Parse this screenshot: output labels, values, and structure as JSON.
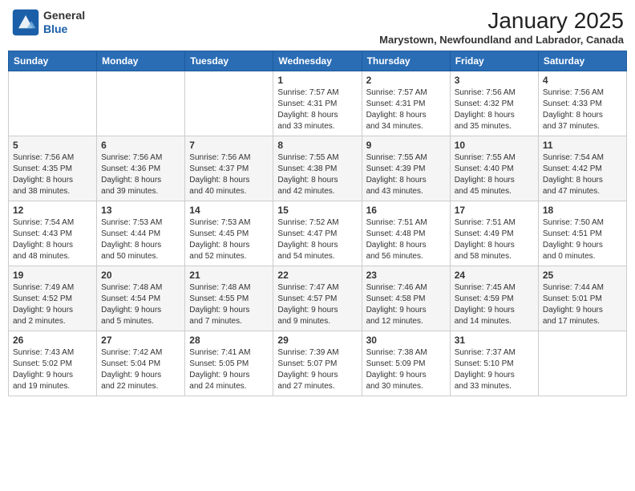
{
  "header": {
    "logo_line1": "General",
    "logo_line2": "Blue",
    "month": "January 2025",
    "location": "Marystown, Newfoundland and Labrador, Canada"
  },
  "weekdays": [
    "Sunday",
    "Monday",
    "Tuesday",
    "Wednesday",
    "Thursday",
    "Friday",
    "Saturday"
  ],
  "weeks": [
    [
      {
        "day": "",
        "info": ""
      },
      {
        "day": "",
        "info": ""
      },
      {
        "day": "",
        "info": ""
      },
      {
        "day": "1",
        "info": "Sunrise: 7:57 AM\nSunset: 4:31 PM\nDaylight: 8 hours\nand 33 minutes."
      },
      {
        "day": "2",
        "info": "Sunrise: 7:57 AM\nSunset: 4:31 PM\nDaylight: 8 hours\nand 34 minutes."
      },
      {
        "day": "3",
        "info": "Sunrise: 7:56 AM\nSunset: 4:32 PM\nDaylight: 8 hours\nand 35 minutes."
      },
      {
        "day": "4",
        "info": "Sunrise: 7:56 AM\nSunset: 4:33 PM\nDaylight: 8 hours\nand 37 minutes."
      }
    ],
    [
      {
        "day": "5",
        "info": "Sunrise: 7:56 AM\nSunset: 4:35 PM\nDaylight: 8 hours\nand 38 minutes."
      },
      {
        "day": "6",
        "info": "Sunrise: 7:56 AM\nSunset: 4:36 PM\nDaylight: 8 hours\nand 39 minutes."
      },
      {
        "day": "7",
        "info": "Sunrise: 7:56 AM\nSunset: 4:37 PM\nDaylight: 8 hours\nand 40 minutes."
      },
      {
        "day": "8",
        "info": "Sunrise: 7:55 AM\nSunset: 4:38 PM\nDaylight: 8 hours\nand 42 minutes."
      },
      {
        "day": "9",
        "info": "Sunrise: 7:55 AM\nSunset: 4:39 PM\nDaylight: 8 hours\nand 43 minutes."
      },
      {
        "day": "10",
        "info": "Sunrise: 7:55 AM\nSunset: 4:40 PM\nDaylight: 8 hours\nand 45 minutes."
      },
      {
        "day": "11",
        "info": "Sunrise: 7:54 AM\nSunset: 4:42 PM\nDaylight: 8 hours\nand 47 minutes."
      }
    ],
    [
      {
        "day": "12",
        "info": "Sunrise: 7:54 AM\nSunset: 4:43 PM\nDaylight: 8 hours\nand 48 minutes."
      },
      {
        "day": "13",
        "info": "Sunrise: 7:53 AM\nSunset: 4:44 PM\nDaylight: 8 hours\nand 50 minutes."
      },
      {
        "day": "14",
        "info": "Sunrise: 7:53 AM\nSunset: 4:45 PM\nDaylight: 8 hours\nand 52 minutes."
      },
      {
        "day": "15",
        "info": "Sunrise: 7:52 AM\nSunset: 4:47 PM\nDaylight: 8 hours\nand 54 minutes."
      },
      {
        "day": "16",
        "info": "Sunrise: 7:51 AM\nSunset: 4:48 PM\nDaylight: 8 hours\nand 56 minutes."
      },
      {
        "day": "17",
        "info": "Sunrise: 7:51 AM\nSunset: 4:49 PM\nDaylight: 8 hours\nand 58 minutes."
      },
      {
        "day": "18",
        "info": "Sunrise: 7:50 AM\nSunset: 4:51 PM\nDaylight: 9 hours\nand 0 minutes."
      }
    ],
    [
      {
        "day": "19",
        "info": "Sunrise: 7:49 AM\nSunset: 4:52 PM\nDaylight: 9 hours\nand 2 minutes."
      },
      {
        "day": "20",
        "info": "Sunrise: 7:48 AM\nSunset: 4:54 PM\nDaylight: 9 hours\nand 5 minutes."
      },
      {
        "day": "21",
        "info": "Sunrise: 7:48 AM\nSunset: 4:55 PM\nDaylight: 9 hours\nand 7 minutes."
      },
      {
        "day": "22",
        "info": "Sunrise: 7:47 AM\nSunset: 4:57 PM\nDaylight: 9 hours\nand 9 minutes."
      },
      {
        "day": "23",
        "info": "Sunrise: 7:46 AM\nSunset: 4:58 PM\nDaylight: 9 hours\nand 12 minutes."
      },
      {
        "day": "24",
        "info": "Sunrise: 7:45 AM\nSunset: 4:59 PM\nDaylight: 9 hours\nand 14 minutes."
      },
      {
        "day": "25",
        "info": "Sunrise: 7:44 AM\nSunset: 5:01 PM\nDaylight: 9 hours\nand 17 minutes."
      }
    ],
    [
      {
        "day": "26",
        "info": "Sunrise: 7:43 AM\nSunset: 5:02 PM\nDaylight: 9 hours\nand 19 minutes."
      },
      {
        "day": "27",
        "info": "Sunrise: 7:42 AM\nSunset: 5:04 PM\nDaylight: 9 hours\nand 22 minutes."
      },
      {
        "day": "28",
        "info": "Sunrise: 7:41 AM\nSunset: 5:05 PM\nDaylight: 9 hours\nand 24 minutes."
      },
      {
        "day": "29",
        "info": "Sunrise: 7:39 AM\nSunset: 5:07 PM\nDaylight: 9 hours\nand 27 minutes."
      },
      {
        "day": "30",
        "info": "Sunrise: 7:38 AM\nSunset: 5:09 PM\nDaylight: 9 hours\nand 30 minutes."
      },
      {
        "day": "31",
        "info": "Sunrise: 7:37 AM\nSunset: 5:10 PM\nDaylight: 9 hours\nand 33 minutes."
      },
      {
        "day": "",
        "info": ""
      }
    ]
  ]
}
